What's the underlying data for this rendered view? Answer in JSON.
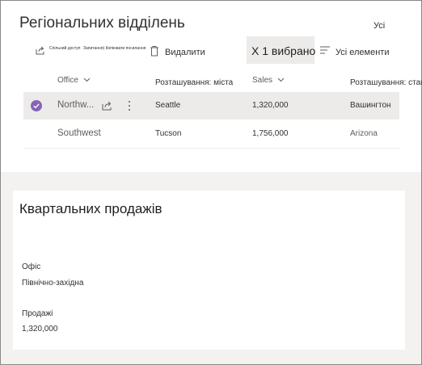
{
  "list": {
    "title": "Регіональних відділень",
    "view_name": "Усі"
  },
  "commandbar": {
    "share_label": "Спільний доступ",
    "copy_link_label": "Запитання) Копіювати посилання",
    "delete_label": "Видалити",
    "selected_count": "X 1 вибрано",
    "all_items_label": "Усі елементи"
  },
  "columns": {
    "office": "Office",
    "city": "Розташування: міста",
    "sales": "Sales",
    "state": "Розташування: стан"
  },
  "rows": [
    {
      "office": "Northw...",
      "city": "Seattle",
      "sales": "1,320,000",
      "state": "Вашингтон",
      "selected": true
    },
    {
      "office": "Southwest",
      "city": "Tucson",
      "sales": "1,756,000",
      "state": "Arizona",
      "selected": false
    }
  ],
  "form": {
    "title": "Квартальних продажів",
    "office_label": "Офіс",
    "office_value": "Північно-західна",
    "sales_label": "Продажі",
    "sales_value": "1,320,000"
  },
  "colors": {
    "accent": "#8764b8",
    "selected_row": "#edebe9"
  }
}
